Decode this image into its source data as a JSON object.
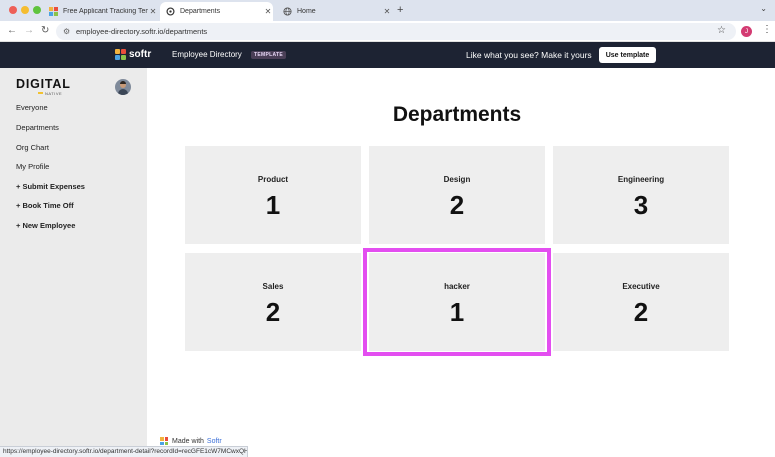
{
  "browser": {
    "tabs": [
      {
        "title": "Free Applicant Tracking Temp",
        "favicon": "softr-icon",
        "active": false
      },
      {
        "title": "Departments",
        "favicon": "softr-icon",
        "active": true
      },
      {
        "title": "Home",
        "favicon": "globe-icon",
        "active": false
      }
    ],
    "url": "employee-directory.softr.io/departments",
    "profile_initial": "J",
    "status_url": "https://employee-directory.softr.io/department-detail?recordId=recGFE1cW7MCwxQHv"
  },
  "banner": {
    "brand": "softr",
    "app_name": "Employee Directory",
    "badge": "TEMPLATE",
    "cta_text": "Like what you see? Make it yours",
    "button_label": "Use template"
  },
  "sidebar": {
    "logo_main": "DIGITAL",
    "logo_sub": "NATIVE",
    "items": [
      {
        "label": "Everyone"
      },
      {
        "label": "Departments"
      },
      {
        "label": "Org Chart"
      },
      {
        "label": "My Profile"
      },
      {
        "label": "+ Submit Expenses"
      },
      {
        "label": "+ Book Time Off"
      },
      {
        "label": "+ New Employee"
      }
    ]
  },
  "main": {
    "title": "Departments",
    "departments": [
      {
        "name": "Product",
        "count": "1"
      },
      {
        "name": "Design",
        "count": "2"
      },
      {
        "name": "Engineering",
        "count": "3"
      },
      {
        "name": "Sales",
        "count": "2"
      },
      {
        "name": "hacker",
        "count": "1"
      },
      {
        "name": "Executive",
        "count": "2"
      }
    ],
    "highlight_color": "#e34ef0"
  },
  "footer": {
    "made_with": "Made with",
    "brand": "Softr"
  },
  "colors": {
    "banner_bg": "#1d2333",
    "sidebar_bg": "#ebebeb",
    "card_bg": "#eeeeee",
    "softr_link": "#3b6fd8"
  }
}
